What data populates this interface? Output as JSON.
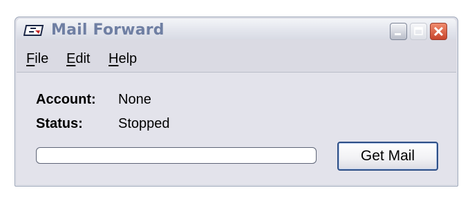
{
  "window": {
    "title": "Mail Forward"
  },
  "menu": {
    "items": [
      "File",
      "Edit",
      "Help"
    ]
  },
  "info": {
    "account_label": "Account:",
    "account_value": "None",
    "status_label": "Status:",
    "status_value": "Stopped"
  },
  "progress": {
    "value": 0
  },
  "actions": {
    "get_mail_label": "Get Mail"
  },
  "colors": {
    "title_text": "#6f7fa3",
    "window_bg": "#e3e3eb",
    "close_button": "#c8452d",
    "default_button_border": "#2e4f86"
  },
  "icons": {
    "app": "mail-window-icon",
    "minimize": "minimize-icon",
    "maximize": "maximize-icon",
    "close": "close-icon"
  }
}
